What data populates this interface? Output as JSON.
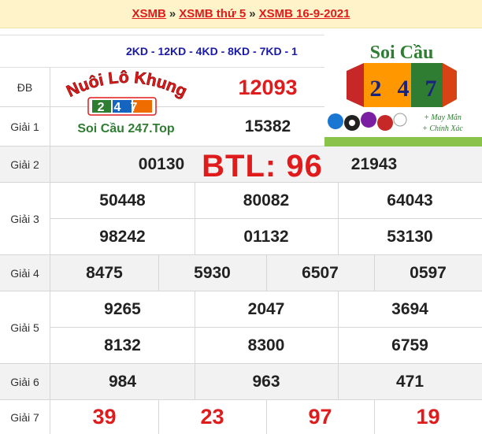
{
  "breadcrumb": {
    "item1": "XSMB",
    "item2": "XSMB thứ 5",
    "item3": "XSMB 16-9-2021",
    "separator": "»"
  },
  "codes": "2KD - 12KD - 4KD - 8KD - 7KD - 1",
  "colors": {
    "accent_red": "#e01b1b",
    "code_blue": "#1a1aa8",
    "header_bg": "#fff3c9"
  },
  "prizes": {
    "db": {
      "label": "ĐB",
      "values": [
        "12093"
      ]
    },
    "g1": {
      "label": "Giải 1",
      "values": [
        "15382"
      ]
    },
    "g2": {
      "label": "Giải 2",
      "values": [
        "00130",
        "21943"
      ]
    },
    "g3": {
      "label": "Giải 3",
      "values": [
        "50448",
        "80082",
        "64043",
        "98242",
        "01132",
        "53130"
      ]
    },
    "g4": {
      "label": "Giải 4",
      "values": [
        "8475",
        "5930",
        "6507",
        "0597"
      ]
    },
    "g5": {
      "label": "Giải 5",
      "values": [
        "9265",
        "2047",
        "3694",
        "8132",
        "8300",
        "6759"
      ]
    },
    "g6": {
      "label": "Giải 6",
      "values": [
        "984",
        "963",
        "471"
      ]
    },
    "g7": {
      "label": "Giải 7",
      "values": [
        "39",
        "23",
        "97",
        "19"
      ]
    }
  },
  "overlay": {
    "btl": "BTL: 96"
  },
  "logo_left": {
    "line1": "Nuôi Lô Khung",
    "badge": "247",
    "line2": "Soi Cầu 247.Top"
  },
  "logo_right": {
    "title": "Soi Cầu",
    "digits": [
      "2",
      "4",
      "7"
    ],
    "slogan1": "+ May Mắn",
    "slogan2": "+ Chính Xác"
  }
}
